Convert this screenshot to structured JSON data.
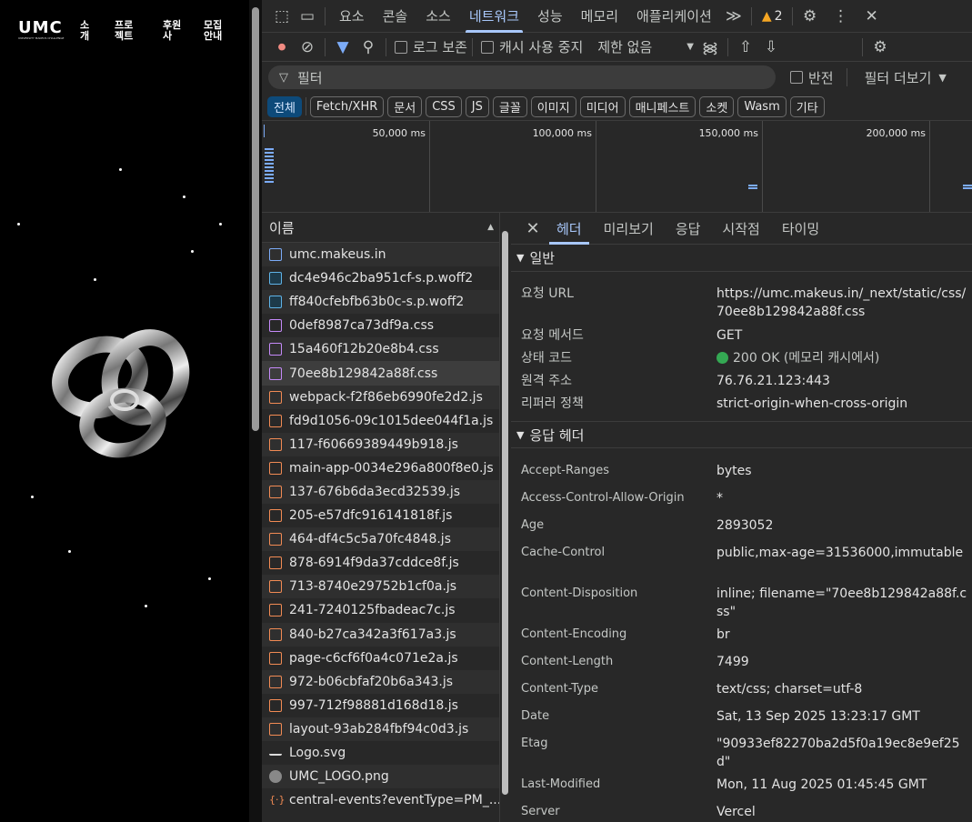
{
  "site": {
    "logo": "UMC",
    "logo_sub": "UNIVERSITY MAKEUS CHALLENGE",
    "nav": [
      {
        "line1": "소",
        "line2": "개"
      },
      {
        "line1": "프로",
        "line2": "젝트"
      },
      {
        "line1": "후원",
        "line2": "사"
      },
      {
        "line1": "모집",
        "line2": "안내"
      }
    ]
  },
  "devtools": {
    "tabs": [
      "요소",
      "콘솔",
      "소스",
      "네트워크",
      "성능",
      "메모리",
      "애플리케이션"
    ],
    "selected_tab": "네트워크",
    "more_tabs": "≫",
    "warning_count": "2",
    "toolbar": {
      "preserve_log": "로그 보존",
      "disable_cache": "캐시 사용 중지",
      "throttling": "제한 없음"
    },
    "filter": {
      "placeholder": "필터",
      "invert": "반전",
      "more_filters": "필터 더보기"
    },
    "type_filters": [
      "전체",
      "Fetch/XHR",
      "문서",
      "CSS",
      "JS",
      "글꼴",
      "이미지",
      "미디어",
      "매니페스트",
      "소켓",
      "Wasm",
      "기타"
    ],
    "timeline_ticks": [
      "50,000 ms",
      "100,000 ms",
      "150,000 ms",
      "200,000 ms"
    ],
    "list_header": "이름",
    "requests": [
      {
        "name": "umc.makeus.in",
        "type": "doc"
      },
      {
        "name": "dc4e946c2ba951cf-s.p.woff2",
        "type": "font"
      },
      {
        "name": "ff840cfebfb63b0c-s.p.woff2",
        "type": "font"
      },
      {
        "name": "0def8987ca73df9a.css",
        "type": "css"
      },
      {
        "name": "15a460f12b20e8b4.css",
        "type": "css"
      },
      {
        "name": "70ee8b129842a88f.css",
        "type": "css"
      },
      {
        "name": "webpack-f2f86eb6990fe2d2.js",
        "type": "js"
      },
      {
        "name": "fd9d1056-09c1015dee044f1a.js",
        "type": "js"
      },
      {
        "name": "117-f60669389449b918.js",
        "type": "js"
      },
      {
        "name": "main-app-0034e296a800f8e0.js",
        "type": "js"
      },
      {
        "name": "137-676b6da3ecd32539.js",
        "type": "js"
      },
      {
        "name": "205-e57dfc916141818f.js",
        "type": "js"
      },
      {
        "name": "464-df4c5c5a70fc4848.js",
        "type": "js"
      },
      {
        "name": "878-6914f9da37cddce8f.js",
        "type": "js"
      },
      {
        "name": "713-8740e29752b1cf0a.js",
        "type": "js"
      },
      {
        "name": "241-7240125fbadeac7c.js",
        "type": "js"
      },
      {
        "name": "840-b27ca342a3f617a3.js",
        "type": "js"
      },
      {
        "name": "page-c6cf6f0a4c071e2a.js",
        "type": "js"
      },
      {
        "name": "972-b06cbfaf20b6a343.js",
        "type": "js"
      },
      {
        "name": "997-712f98881d168d18.js",
        "type": "js"
      },
      {
        "name": "layout-93ab284fbf94c0d3.js",
        "type": "js"
      },
      {
        "name": "Logo.svg",
        "type": "svg"
      },
      {
        "name": "UMC_LOGO.png",
        "type": "png"
      },
      {
        "name": "central-events?eventType=PM_...",
        "type": "evt"
      }
    ],
    "selected_request": "70ee8b129842a88f.css",
    "detail_tabs": [
      "헤더",
      "미리보기",
      "응답",
      "시작점",
      "타이밍"
    ],
    "general": {
      "title": "일반",
      "rows": [
        {
          "k": "요청 URL",
          "v": "https://umc.makeus.in/_next/static/css/70ee8b129842a88f.css"
        },
        {
          "k": "요청 메서드",
          "v": "GET"
        },
        {
          "k": "상태 코드",
          "v": "200 OK (메모리 캐시에서)"
        },
        {
          "k": "원격 주소",
          "v": "76.76.21.123:443"
        },
        {
          "k": "리퍼러 정책",
          "v": "strict-origin-when-cross-origin"
        }
      ]
    },
    "response_headers": {
      "title": "응답 헤더",
      "rows": [
        {
          "k": "Accept-Ranges",
          "v": "bytes"
        },
        {
          "k": "Access-Control-Allow-Origin",
          "v": "*"
        },
        {
          "k": "Age",
          "v": "2893052"
        },
        {
          "k": "Cache-Control",
          "v": "public,max-age=31536000,immutable"
        },
        {
          "k": "Content-Disposition",
          "v": "inline; filename=\"70ee8b129842a88f.css\""
        },
        {
          "k": "Content-Encoding",
          "v": "br"
        },
        {
          "k": "Content-Length",
          "v": "7499"
        },
        {
          "k": "Content-Type",
          "v": "text/css; charset=utf-8"
        },
        {
          "k": "Date",
          "v": "Sat, 13 Sep 2025 13:23:17 GMT"
        },
        {
          "k": "Etag",
          "v": "\"90933ef82270ba2d5f0a19ec8e9ef25d\""
        },
        {
          "k": "Last-Modified",
          "v": "Mon, 11 Aug 2025 01:45:45 GMT"
        },
        {
          "k": "Server",
          "v": "Vercel"
        }
      ]
    }
  }
}
